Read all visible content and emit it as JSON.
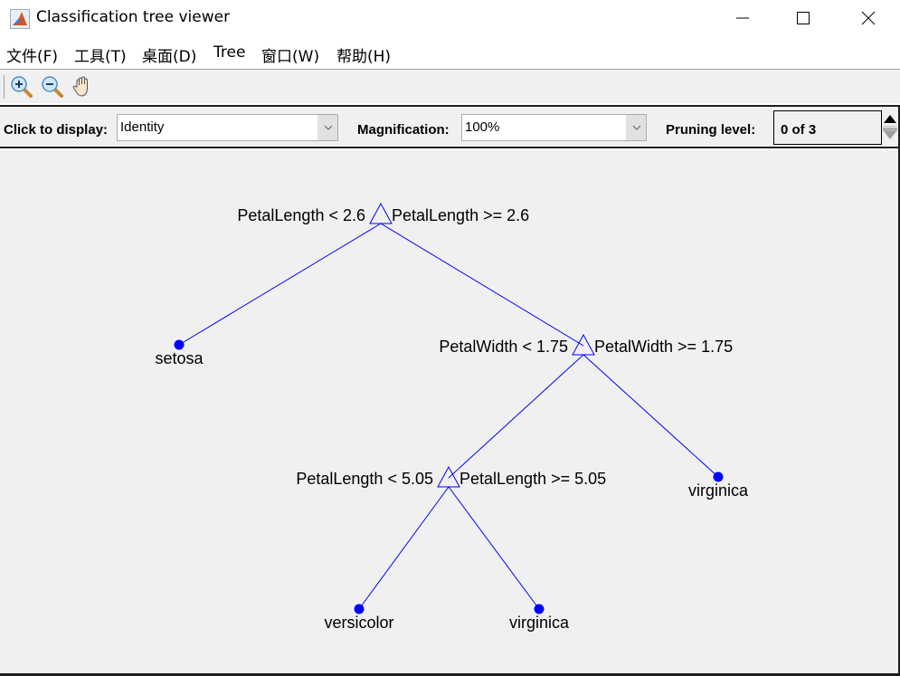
{
  "window": {
    "title": "Classification tree viewer",
    "controls": [
      "minimize",
      "maximize",
      "close"
    ]
  },
  "menubar": {
    "items": [
      {
        "label": "文件(F)"
      },
      {
        "label": "工具(T)"
      },
      {
        "label": "桌面(D)"
      },
      {
        "label": "Tree"
      },
      {
        "label": "窗口(W)"
      },
      {
        "label": "帮助(H)"
      }
    ]
  },
  "toolbar": {
    "buttons": [
      {
        "icon": "zoom-in-icon"
      },
      {
        "icon": "zoom-out-icon"
      },
      {
        "icon": "pan-hand-icon"
      }
    ]
  },
  "controls": {
    "click_to_display_label": "Click to display:",
    "click_to_display_value": "Identity",
    "magnification_label": "Magnification:",
    "magnification_value": "100%",
    "pruning_label": "Pruning level:",
    "pruning_value": "0 of 3"
  },
  "tree": {
    "colors": {
      "line": "#0000ff",
      "text": "#000000"
    },
    "branch_nodes": [
      {
        "id": 1,
        "left_rule": "PetalLength < 2.6",
        "right_rule": "PetalLength >= 2.6"
      },
      {
        "id": 3,
        "left_rule": "PetalWidth < 1.75",
        "right_rule": "PetalWidth >= 1.75"
      },
      {
        "id": 4,
        "left_rule": "PetalLength < 5.05",
        "right_rule": "PetalLength >= 5.05"
      }
    ],
    "leaf_nodes": [
      {
        "id": 2,
        "label": "setosa"
      },
      {
        "id": 5,
        "label": "virginica"
      },
      {
        "id": 6,
        "label": "versicolor"
      },
      {
        "id": 7,
        "label": "virginica"
      }
    ],
    "edges": [
      [
        1,
        2
      ],
      [
        1,
        3
      ],
      [
        3,
        4
      ],
      [
        3,
        5
      ],
      [
        4,
        6
      ],
      [
        4,
        7
      ]
    ]
  }
}
